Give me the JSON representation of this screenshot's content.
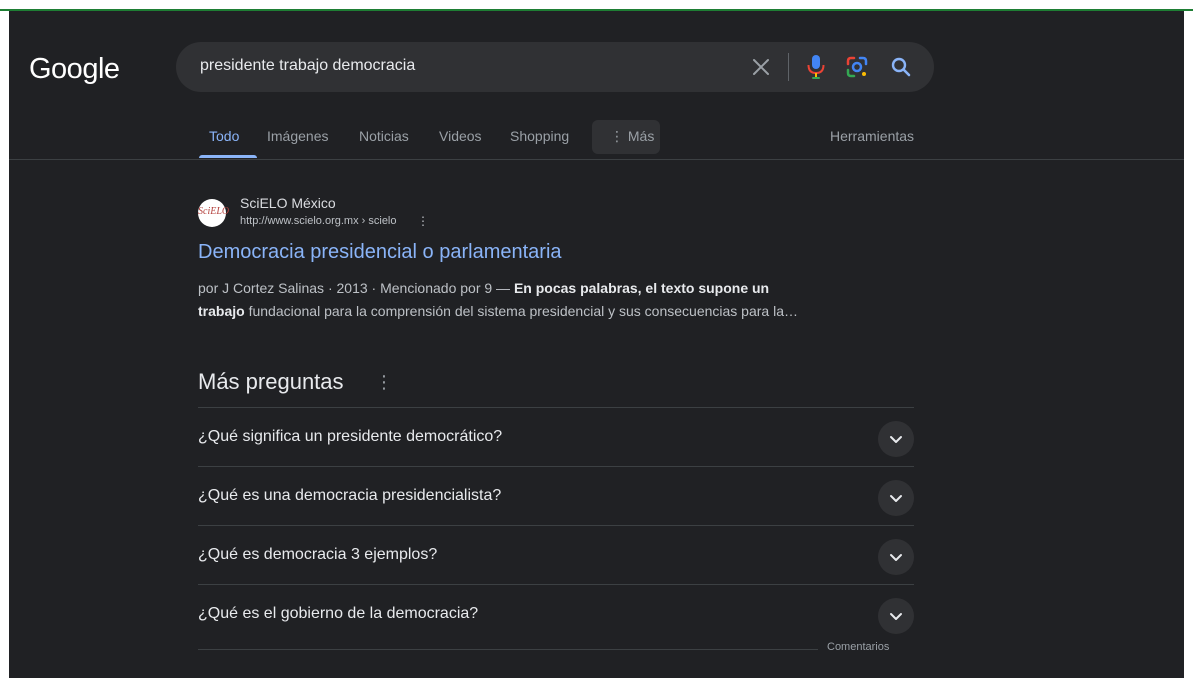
{
  "app": {
    "logo": "Google",
    "accent_color": "#8ab4f8",
    "background_color": "#202124"
  },
  "search": {
    "query": "presidente trabajo democracia",
    "icons": [
      "close-icon",
      "mic-icon",
      "lens-icon",
      "search-icon"
    ]
  },
  "tabs": {
    "items": [
      "Todo",
      "Imágenes",
      "Noticias",
      "Videos",
      "Shopping",
      "⋮ Más"
    ],
    "active": "Todo",
    "tools": "Herramientas"
  },
  "result": {
    "favicon_text": "SciELO",
    "site_name": "SciELO México",
    "url": "http://www.scielo.org.mx › scielo",
    "title": "Democracia presidencial o parlamentaria",
    "snippet_meta": "por J Cortez Salinas · 2013 · Mencionado por 9 — ",
    "snippet_bold_1": "En pocas palabras, el texto supone un",
    "snippet_bold_2": "trabajo",
    "snippet_rest": " fundacional para la comprensión del sistema presidencial y sus consecuencias para la…"
  },
  "paa": {
    "title": "Más preguntas",
    "questions": [
      "¿Qué significa un presidente democrático?",
      "¿Qué es una democracia presidencialista?",
      "¿Qué es democracia 3 ejemplos?",
      "¿Qué es el gobierno de la democracia?"
    ],
    "feedback": "Comentarios"
  }
}
